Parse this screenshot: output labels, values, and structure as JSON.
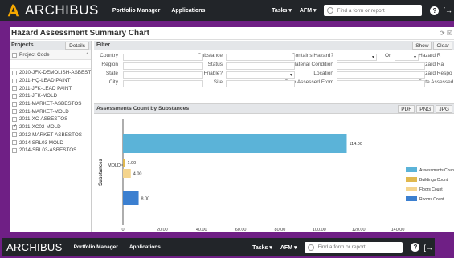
{
  "app": {
    "logo_text": "ARCHIBUS",
    "menu": [
      "Portfolio Manager",
      "Applications"
    ],
    "tasks_label": "Tasks ▾",
    "afm_label": "AFM ▾",
    "search_placeholder": "Find a form or report",
    "help_label": "?",
    "logout_label": "[→"
  },
  "page": {
    "title": "Hazard Assessment Summary Chart",
    "title_icons": "⟳ ☒"
  },
  "left_panel": {
    "title": "Projects",
    "details_button": "Details",
    "column_header": "Project Code",
    "projects": [
      {
        "code": "2010-JFK-DEMOLISH-ASBESTOS",
        "checked": false
      },
      {
        "code": "2011-HQ-LEAD PAINT",
        "checked": false
      },
      {
        "code": "2011-JFK-LEAD PAINT",
        "checked": false
      },
      {
        "code": "2011-JFK-MOLD",
        "checked": false
      },
      {
        "code": "2011-MARKET-ASBESTOS",
        "checked": false
      },
      {
        "code": "2011-MARKET-MOLD",
        "checked": false
      },
      {
        "code": "2011-XC-ASBESTOS",
        "checked": false
      },
      {
        "code": "2011-XC02-MOLD",
        "checked": true
      },
      {
        "code": "2012-MARKET-ASBESTOS",
        "checked": false
      },
      {
        "code": "2014 SRL03 MOLD",
        "checked": false
      },
      {
        "code": "2014-SRL03-ASBESTOS",
        "checked": false
      }
    ]
  },
  "filter": {
    "title": "Filter",
    "show_button": "Show",
    "clear_button": "Clear",
    "rows": [
      [
        "Country",
        "Substance",
        "Contains Hazard?",
        "Or",
        "Hazard R"
      ],
      [
        "Region",
        "Status",
        "Material Condition",
        "",
        "Hazard Ra"
      ],
      [
        "State",
        "Friable?",
        "Location",
        "",
        "Hazard Respo"
      ],
      [
        "City",
        "Site",
        "Date Assessed From",
        "",
        "Date Assessed"
      ]
    ]
  },
  "chart_panel": {
    "title": "Assessments Count by Substances",
    "buttons": [
      "PDF",
      "PNG",
      "JPG"
    ]
  },
  "chart_data": {
    "type": "bar",
    "orientation": "horizontal",
    "categories": [
      "",
      "MOLD",
      ""
    ],
    "ylabel": "Substances",
    "xlabel": "",
    "xlim": [
      0,
      140
    ],
    "x_ticks": [
      "0",
      "20.00",
      "40.00",
      "60.00",
      "80.00",
      "100.00",
      "120.00",
      "140.00"
    ],
    "series": [
      {
        "name": "Assessments Count",
        "color": "#5bb3d8",
        "values": [
          114,
          0,
          0
        ]
      },
      {
        "name": "Buildings Count",
        "color": "#e0b84e",
        "values": [
          0,
          1,
          0
        ]
      },
      {
        "name": "Floors Count",
        "color": "#f4d48d",
        "values": [
          0,
          4,
          0
        ]
      },
      {
        "name": "Rooms Count",
        "color": "#3b7fd0",
        "values": [
          0,
          0,
          8
        ]
      }
    ],
    "bars": [
      {
        "series": 0,
        "value": 114,
        "label": "114.00"
      },
      {
        "series": 1,
        "value": 1,
        "label": "1.00"
      },
      {
        "series": 2,
        "value": 4,
        "label": "4.00"
      },
      {
        "series": 3,
        "value": 8,
        "label": "8.00"
      }
    ],
    "legend_position": "right"
  },
  "bottom_bar": {
    "logo_text": "ARCHIBUS",
    "menu": [
      "Portfolio Manager",
      "Applications"
    ],
    "tasks_label": "Tasks ▾",
    "afm_label": "AFM ▾",
    "search_placeholder": "Find a form or report"
  }
}
